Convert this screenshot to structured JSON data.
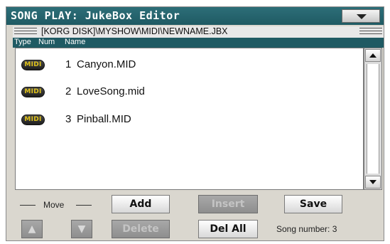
{
  "window": {
    "title": "SONG PLAY: JukeBox Editor",
    "menu_icon": "chevron-down-icon"
  },
  "pathbar": {
    "path": "[KORG DISK]\\MYSHOW\\MIDI\\NEWNAME.JBX"
  },
  "columns": {
    "type": "Type",
    "num": "Num",
    "name": "Name"
  },
  "songs": [
    {
      "badge": "MIDI",
      "num": "1",
      "name": "Canyon.MID"
    },
    {
      "badge": "MIDI",
      "num": "2",
      "name": "LoveSong.mid"
    },
    {
      "badge": "MIDI",
      "num": "3",
      "name": "Pinball.MID"
    }
  ],
  "controls": {
    "move_label": "Move",
    "add": "Add",
    "insert": "Insert",
    "save": "Save",
    "delete": "Delete",
    "del_all": "Del All",
    "move_up_icon": "arrow-up-icon",
    "move_down_icon": "arrow-down-icon",
    "song_number": "Song number:  3"
  },
  "colors": {
    "title_bar": "#1f5a63",
    "badge_text": "#e0c21a",
    "panel_bg": "#dad7cf"
  }
}
